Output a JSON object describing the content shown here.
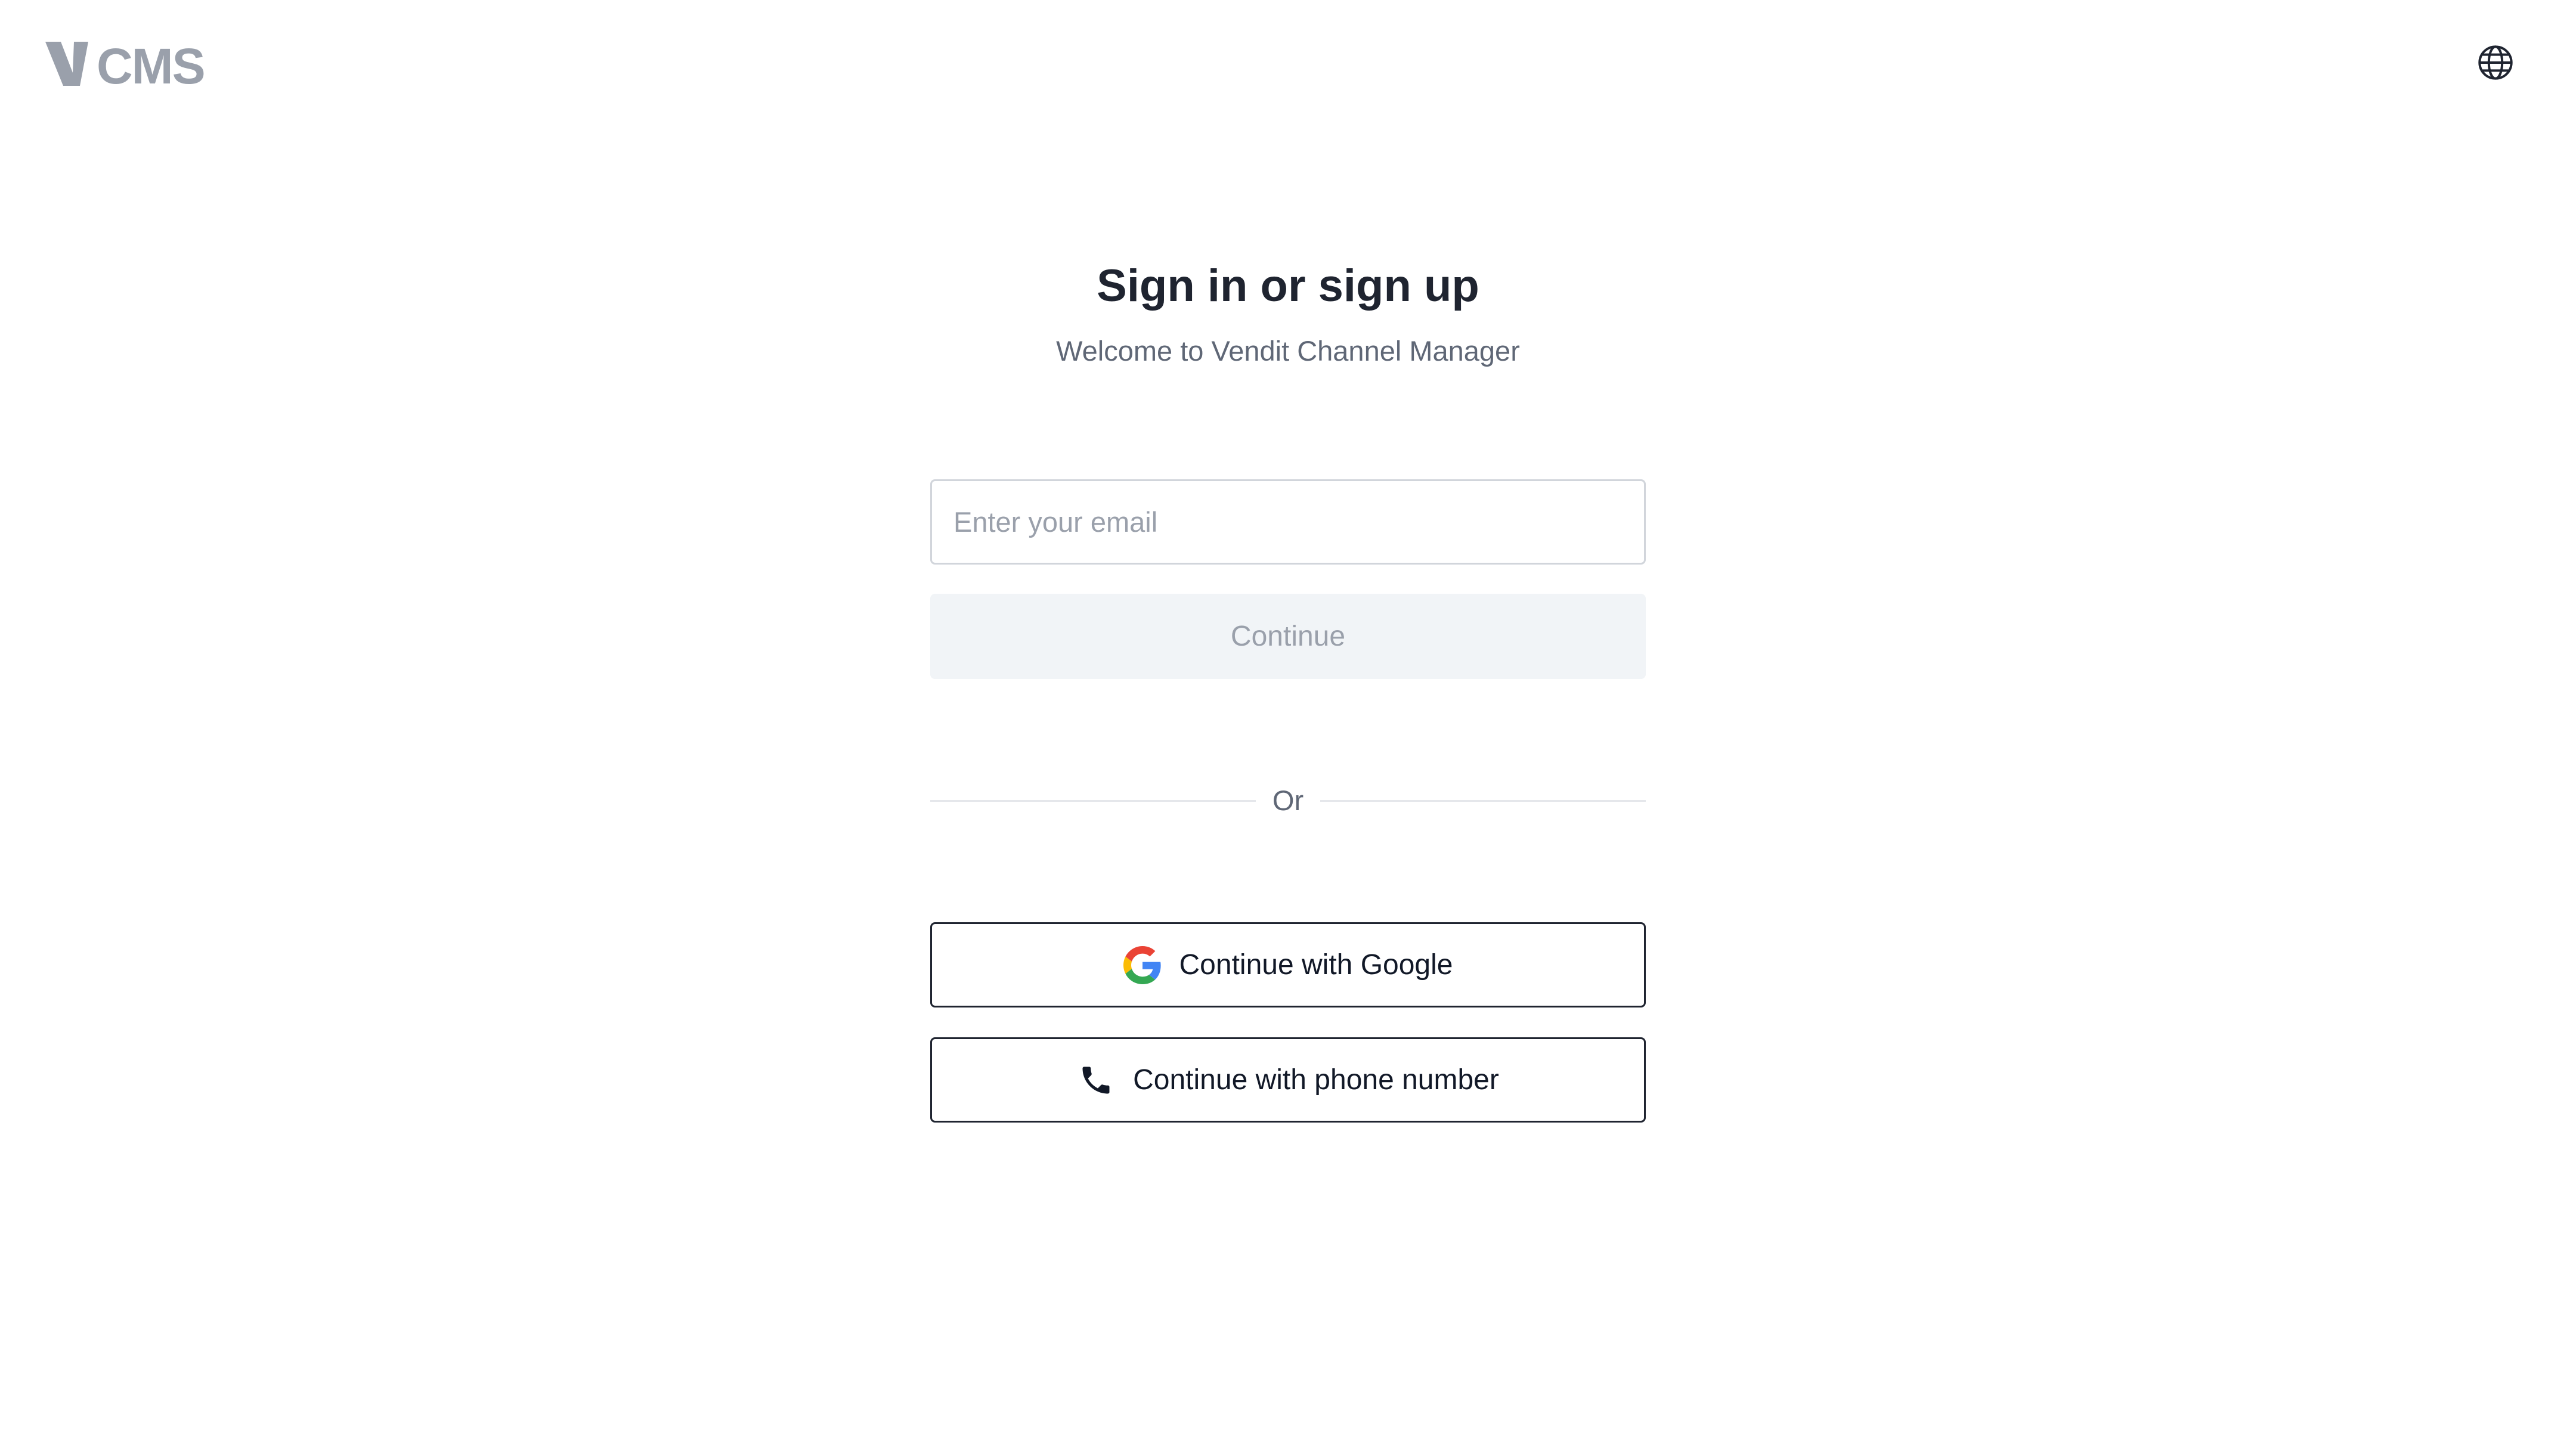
{
  "header": {
    "logo_text": "VCMS",
    "language_icon": "globe-icon"
  },
  "main": {
    "title": "Sign in or sign up",
    "subtitle": "Welcome to Vendit Channel Manager"
  },
  "form": {
    "email_placeholder": "Enter your email",
    "email_value": "",
    "continue_label": "Continue",
    "continue_disabled": true
  },
  "divider": {
    "label": "Or"
  },
  "social": {
    "google_label": "Continue with Google",
    "google_icon": "google-icon",
    "phone_label": "Continue with phone number",
    "phone_icon": "phone-icon"
  },
  "colors": {
    "logo_gray": "#9aa0ab",
    "heading": "#1f2430",
    "muted_text": "#5f6776",
    "disabled_button_bg": "#f1f4f7",
    "border": "#d1d5db"
  }
}
